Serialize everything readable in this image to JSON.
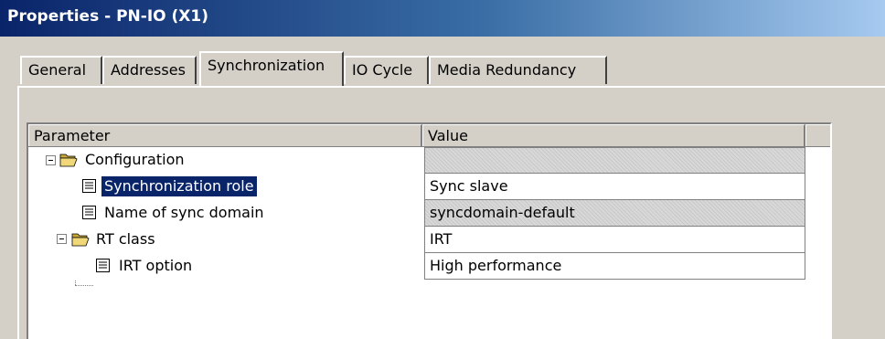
{
  "window": {
    "title": "Properties - PN-IO (X1)"
  },
  "tabs": [
    {
      "label": "General"
    },
    {
      "label": "Addresses"
    },
    {
      "label": "Synchronization",
      "active": true
    },
    {
      "label": "IO Cycle"
    },
    {
      "label": "Media Redundancy"
    }
  ],
  "table": {
    "columns": [
      "Parameter",
      "Value"
    ],
    "rows": [
      {
        "name": "Configuration",
        "icon": "folder-icon",
        "value": "",
        "level": 0,
        "expanded": true,
        "state": "readonly"
      },
      {
        "name": "Synchronization role",
        "icon": "document-icon",
        "value": "Sync slave",
        "level": 1,
        "selected": true,
        "state": "editable"
      },
      {
        "name": "Name of sync domain",
        "icon": "document-icon",
        "value": "syncdomain-default",
        "level": 1,
        "state": "readonly"
      },
      {
        "name": "RT class",
        "icon": "folder-icon",
        "value": "IRT",
        "level": 1,
        "expanded": true,
        "state": "editable"
      },
      {
        "name": "IRT option",
        "icon": "document-icon",
        "value": "High performance",
        "level": 2,
        "state": "editable"
      }
    ]
  },
  "colors": {
    "selection": "#0a246a",
    "title_start": "#0a246a",
    "title_end": "#a6caf0",
    "dialog_face": "#d4d0c8"
  }
}
